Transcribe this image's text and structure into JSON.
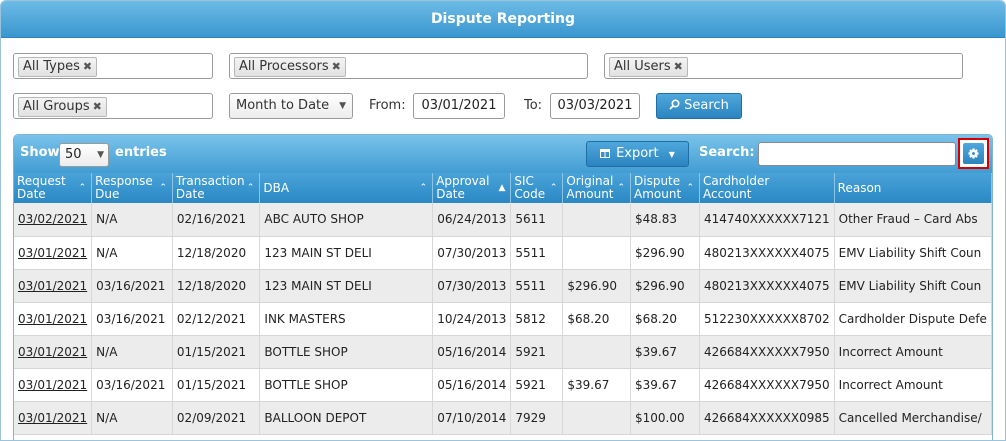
{
  "title": "Dispute Reporting",
  "filters": {
    "types": "All Types",
    "processors": "All Processors",
    "users": "All Users",
    "groups": "All Groups",
    "remove_glyph": "✖",
    "period": "Month to Date",
    "from_label": "From:",
    "from_date": "03/01/2021",
    "to_label": "To:",
    "to_date": "03/03/2021",
    "search_button": "Search"
  },
  "toolbar": {
    "show_label": "Show",
    "entries_value": "50",
    "entries_label": "entries",
    "export_label": "Export",
    "search_label": "Search:"
  },
  "columns": [
    {
      "label": "Request\nDate",
      "sort": "both"
    },
    {
      "label": "Response\nDue",
      "sort": "both"
    },
    {
      "label": "Transaction\nDate",
      "sort": "both"
    },
    {
      "label": "DBA",
      "sort": "both"
    },
    {
      "label": "Approval\nDate",
      "sort": "asc"
    },
    {
      "label": "SIC\nCode",
      "sort": "both"
    },
    {
      "label": "Original\nAmount",
      "sort": "both"
    },
    {
      "label": "Dispute\nAmount",
      "sort": "both"
    },
    {
      "label": "Cardholder\nAccount",
      "sort": "none"
    },
    {
      "label": "Reason",
      "sort": "none"
    }
  ],
  "rows": [
    [
      "03/02/2021",
      "N/A",
      "02/16/2021",
      "ABC AUTO SHOP",
      "06/24/2013",
      "5611",
      "",
      "$48.83",
      "414740XXXXXX7121",
      "Other Fraud – Card Abs"
    ],
    [
      "03/01/2021",
      "N/A",
      "12/18/2020",
      "123 MAIN ST DELI",
      "07/30/2013",
      "5511",
      "",
      "$296.90",
      "480213XXXXXX4075",
      "EMV Liability Shift Coun"
    ],
    [
      "03/01/2021",
      "03/16/2021",
      "12/18/2020",
      "123 MAIN ST DELI",
      "07/30/2013",
      "5511",
      "$296.90",
      "$296.90",
      "480213XXXXXX4075",
      "EMV Liability Shift Coun"
    ],
    [
      "03/01/2021",
      "03/16/2021",
      "02/12/2021",
      "INK MASTERS",
      "10/24/2013",
      "5812",
      "$68.20",
      "$68.20",
      "512230XXXXXX8702",
      "Cardholder Dispute Defe"
    ],
    [
      "03/01/2021",
      "N/A",
      "01/15/2021",
      "BOTTLE SHOP",
      "05/16/2014",
      "5921",
      "",
      "$39.67",
      "426684XXXXXX7950",
      "Incorrect Amount"
    ],
    [
      "03/01/2021",
      "03/16/2021",
      "01/15/2021",
      "BOTTLE SHOP",
      "05/16/2014",
      "5921",
      "$39.67",
      "$39.67",
      "426684XXXXXX7950",
      "Incorrect Amount"
    ],
    [
      "03/01/2021",
      "N/A",
      "02/09/2021",
      "BALLOON DEPOT",
      "07/10/2014",
      "7929",
      "",
      "$100.00",
      "426684XXXXXX0985",
      "Cancelled Merchandise/"
    ]
  ],
  "colors": {
    "header_blue": "#3a97cf",
    "highlight_red": "#d40000"
  }
}
